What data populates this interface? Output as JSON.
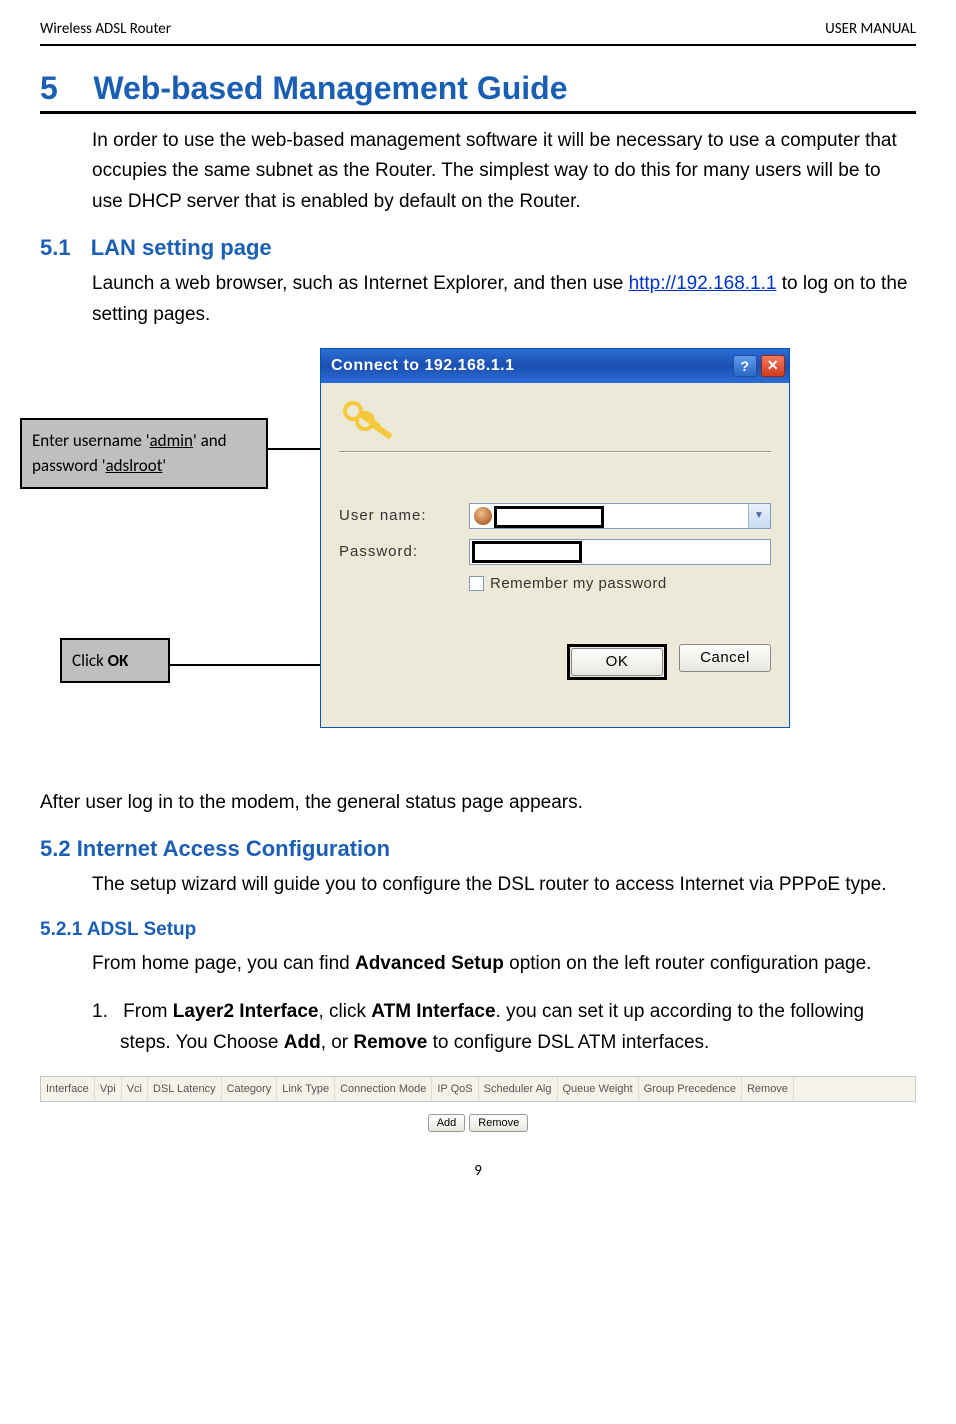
{
  "header": {
    "left": "Wireless ADSL Router",
    "right": "USER MANUAL"
  },
  "h1": {
    "num": "5",
    "title": "Web-based Management Guide"
  },
  "intro": "In order to use the web-based management software it will be necessary to use a computer that occupies the same subnet as the Router. The simplest way to do this for many users will be to use DHCP server that is enabled by default on the Router.",
  "s51": {
    "num": "5.1",
    "title": "LAN setting page"
  },
  "s51_text_a": "Launch a web browser, such as Internet Explorer, and then use ",
  "s51_link": "http://192.168.1.1",
  "s51_text_b": " to log on to the setting pages.",
  "dialog": {
    "title": "Connect to 192.168.1.1",
    "user_label": "User name:",
    "pwd_label": "Password:",
    "remember": "Remember my password",
    "ok": "OK",
    "cancel": "Cancel"
  },
  "callout_creds_a": "Enter username '",
  "callout_creds_user": "admin",
  "callout_creds_b": "' and password '",
  "callout_creds_pwd": "adslroot",
  "callout_creds_c": "'",
  "callout_ok_a": "Click ",
  "callout_ok_b": "OK",
  "after_login": "After user log in to the modem, the general status page appears.",
  "s52": {
    "title": "5.2 Internet Access Configuration"
  },
  "s52_text": "The setup wizard will guide you to configure the DSL router to access Internet via PPPoE type.",
  "s521": {
    "title": "5.2.1 ADSL Setup"
  },
  "s521_text_a": "From home page, you can find ",
  "s521_text_bold": "Advanced Setup",
  "s521_text_b": " option on the left router configuration page.",
  "ol1_num": "1.",
  "ol1_a": "From ",
  "ol1_b1": "Layer2 Interface",
  "ol1_c": ", click ",
  "ol1_b2": "ATM Interface",
  "ol1_d": ". you can set it up according to the following steps. You Choose ",
  "ol1_b3": "Add",
  "ol1_e": ", or ",
  "ol1_b4": "Remove",
  "ol1_f": " to configure DSL ATM interfaces.",
  "table_headers": [
    "Interface",
    "Vpi",
    "Vci",
    "DSL Latency",
    "Category",
    "Link Type",
    "Connection Mode",
    "IP QoS",
    "Scheduler Alg",
    "Queue Weight",
    "Group Precedence",
    "Remove"
  ],
  "btn_add": "Add",
  "btn_remove": "Remove",
  "page_num": "9"
}
